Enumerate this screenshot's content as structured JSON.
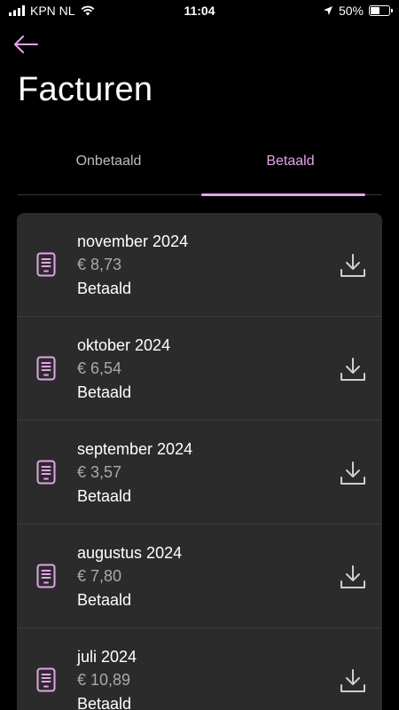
{
  "status_bar": {
    "carrier": "KPN NL",
    "time": "11:04",
    "battery": "50%",
    "battery_level": 0.5
  },
  "header": {
    "title": "Facturen",
    "back_icon": "arrow-left-icon"
  },
  "tabs": [
    {
      "label": "Onbetaald",
      "active": false
    },
    {
      "label": "Betaald",
      "active": true
    }
  ],
  "invoices": [
    {
      "month": "november 2024",
      "amount": "€ 8,73",
      "status": "Betaald"
    },
    {
      "month": "oktober 2024",
      "amount": "€ 6,54",
      "status": "Betaald"
    },
    {
      "month": "september 2024",
      "amount": "€ 3,57",
      "status": "Betaald"
    },
    {
      "month": "augustus 2024",
      "amount": "€ 7,80",
      "status": "Betaald"
    },
    {
      "month": "juli 2024",
      "amount": "€ 10,89",
      "status": "Betaald"
    }
  ],
  "colors": {
    "accent": "#e4a4e9",
    "background": "#000000",
    "card": "#2b2b2b",
    "muted_text": "#a9a9a9"
  }
}
